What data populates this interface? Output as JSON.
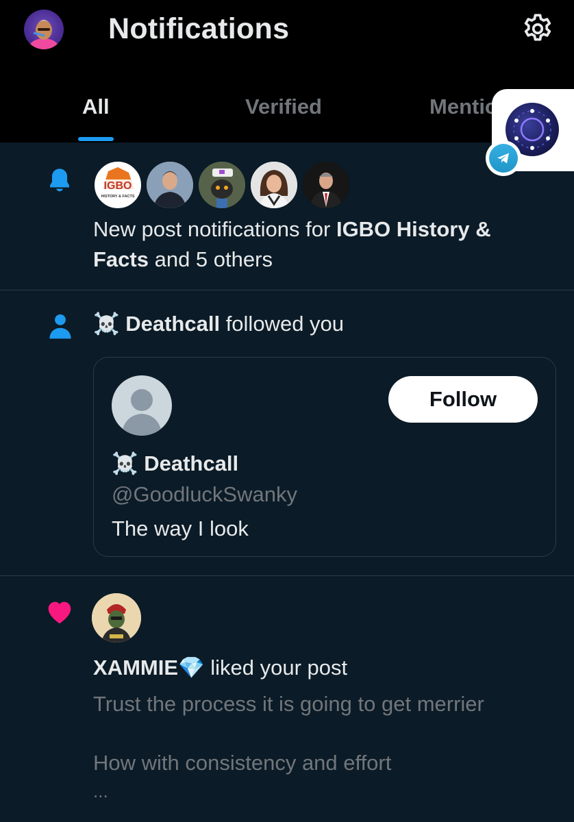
{
  "header": {
    "title": "Notifications",
    "icons": {
      "settings": "gear-icon",
      "profile": "avatar"
    }
  },
  "tabs": [
    {
      "label": "All",
      "active": true
    },
    {
      "label": "Verified",
      "active": false
    },
    {
      "label": "Mentions",
      "active": false
    }
  ],
  "notifications": [
    {
      "type": "new-post",
      "icon": "bell-icon",
      "text_prefix": "New post notifications for ",
      "bold_name": "IGBO History & Facts",
      "bold_name_line1": "IGBO History &",
      "bold_name_line2": "Facts",
      "text_suffix": " and 5 others",
      "avatar_count": 5,
      "first_avatar_text": "IGBO",
      "first_avatar_subtext": "HISTORY & FACTS"
    },
    {
      "type": "follow",
      "icon": "person-icon",
      "actor": "Deathcall",
      "actor_emoji": "☠️",
      "action": " followed you",
      "card": {
        "name": "Deathcall",
        "handle": "@GoodluckSwanky",
        "bio": "The way I look",
        "follow_label": "Follow"
      }
    },
    {
      "type": "like",
      "icon": "heart-icon",
      "actor": "XAMMIE💎",
      "action": " liked your post",
      "post_line1": "Trust the process it is going to get merrier",
      "post_line2": "How with consistency and effort",
      "post_more": "..."
    }
  ],
  "colors": {
    "background": "#0b1b27",
    "header_bg": "#000000",
    "accent": "#1d9bf0",
    "like": "#f91880",
    "muted_text": "#71767b",
    "primary_text": "#e7e9ea"
  }
}
